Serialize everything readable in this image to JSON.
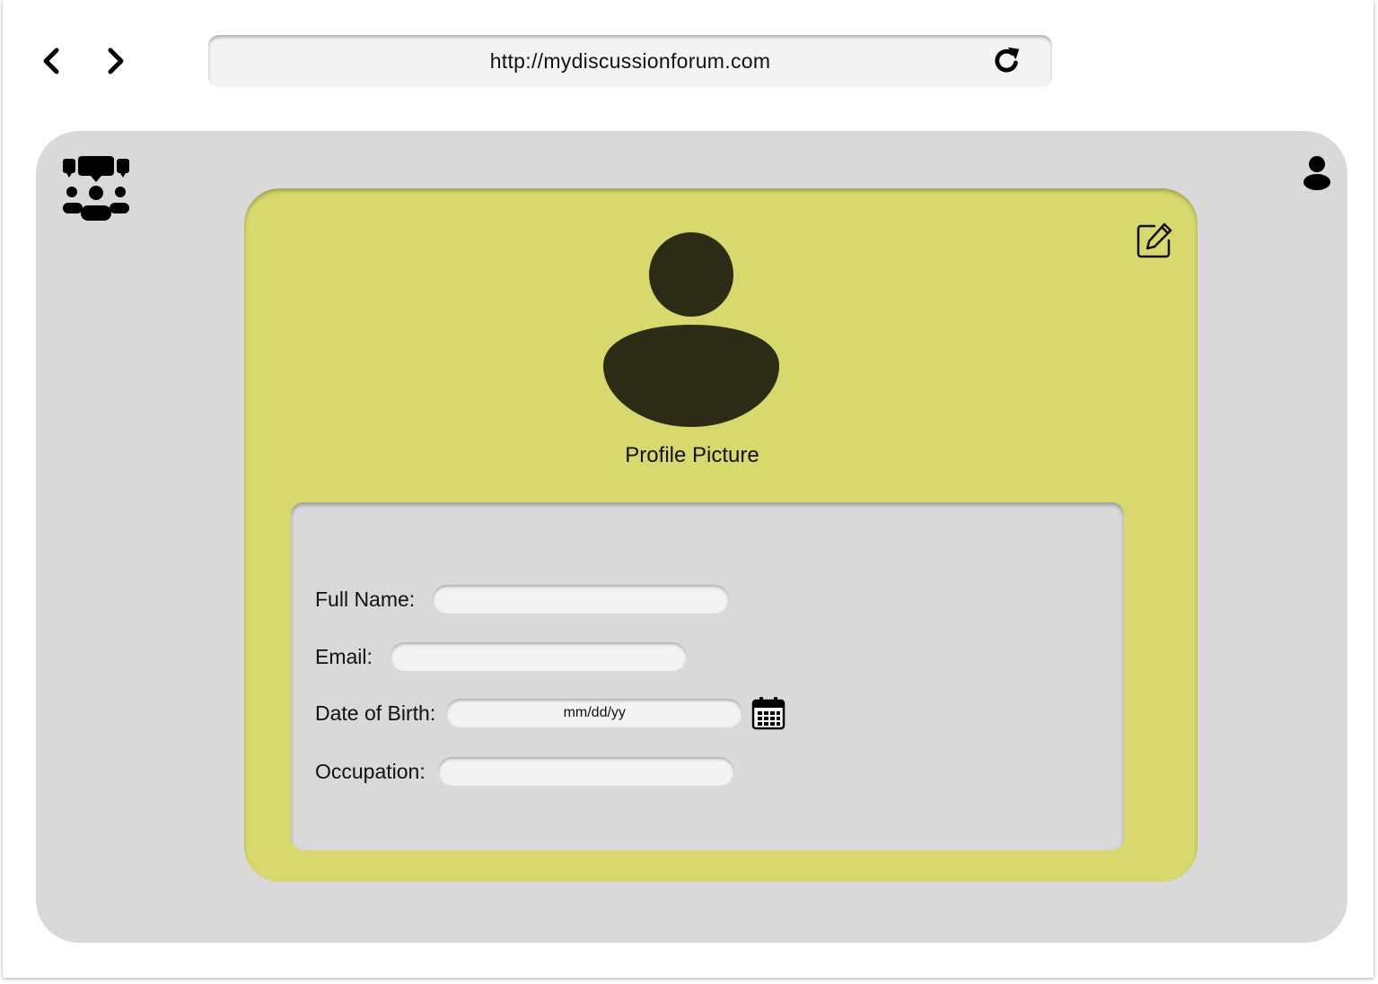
{
  "browser": {
    "url": "http://mydiscussionforum.com",
    "back_icon": "chevron-left-icon",
    "forward_icon": "chevron-right-icon",
    "reload_icon": "reload-icon"
  },
  "app": {
    "logo_icon": "discussion-group-icon",
    "user_icon": "user-icon",
    "colors": {
      "background": "#d9d9d9",
      "card": "#d7d86d",
      "avatar": "#2b2b16",
      "input": "#f3f3f3"
    }
  },
  "profile": {
    "edit_icon": "edit-icon",
    "picture_label": "Profile Picture",
    "avatar_icon": "avatar-icon"
  },
  "form": {
    "full_name_label": "Full Name:",
    "full_name_value": "",
    "email_label": "Email:",
    "email_value": "",
    "dob_label": "Date of Birth:",
    "dob_placeholder": "mm/dd/yy",
    "calendar_icon": "calendar-icon",
    "occupation_label": "Occupation:",
    "occupation_value": ""
  }
}
